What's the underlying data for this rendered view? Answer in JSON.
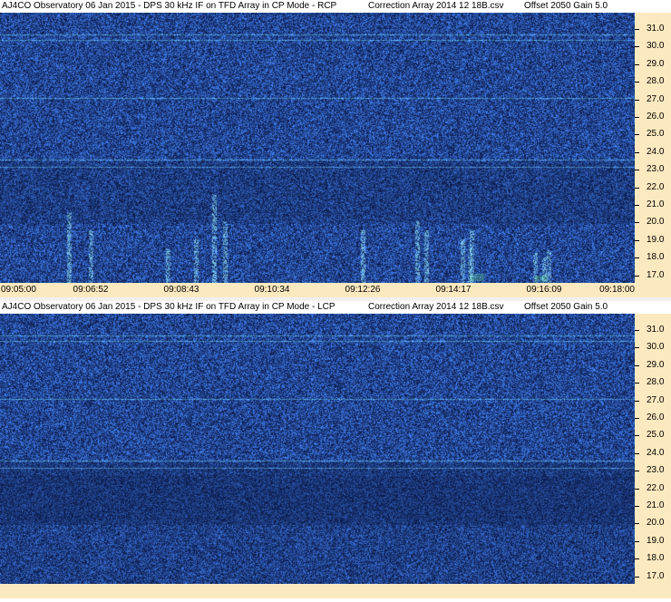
{
  "panels": [
    {
      "id": "rcp",
      "title": "AJ4CO Observatory 06 Jan 2015 - DPS 30 kHz IF on TFD Array in CP Mode - RCP",
      "correction": "Correction Array 2014 12 18B.csv",
      "gain": "Offset 2050  Gain 5.0",
      "show_time_labels": true
    },
    {
      "id": "lcp",
      "title": "AJ4CO Observatory 06 Jan 2015 - DPS 30 kHz IF on TFD Array in CP Mode - LCP",
      "correction": "Correction Array 2014 12 18B.csv",
      "gain": "Offset 2050  Gain 5.0",
      "show_time_labels": false
    }
  ],
  "freq_axis": {
    "unit_hint": "MHz",
    "labels": [
      "31.0",
      "30.0",
      "29.0",
      "28.0",
      "27.0",
      "26.0",
      "25.0",
      "24.0",
      "23.0",
      "22.0",
      "21.0",
      "20.0",
      "19.0",
      "18.0",
      "17.0"
    ]
  },
  "time_axis": {
    "labels": [
      "09:05:00",
      "09:06:52",
      "09:08:43",
      "09:10:34",
      "09:12:26",
      "09:14:17",
      "09:16:09",
      "09:18:00"
    ]
  },
  "colors": {
    "axis_bg": "#fde9c0",
    "spectro_base": "#1a3fb8",
    "spectro_dark": "#06124a",
    "burst": "#9ef0ff"
  }
}
